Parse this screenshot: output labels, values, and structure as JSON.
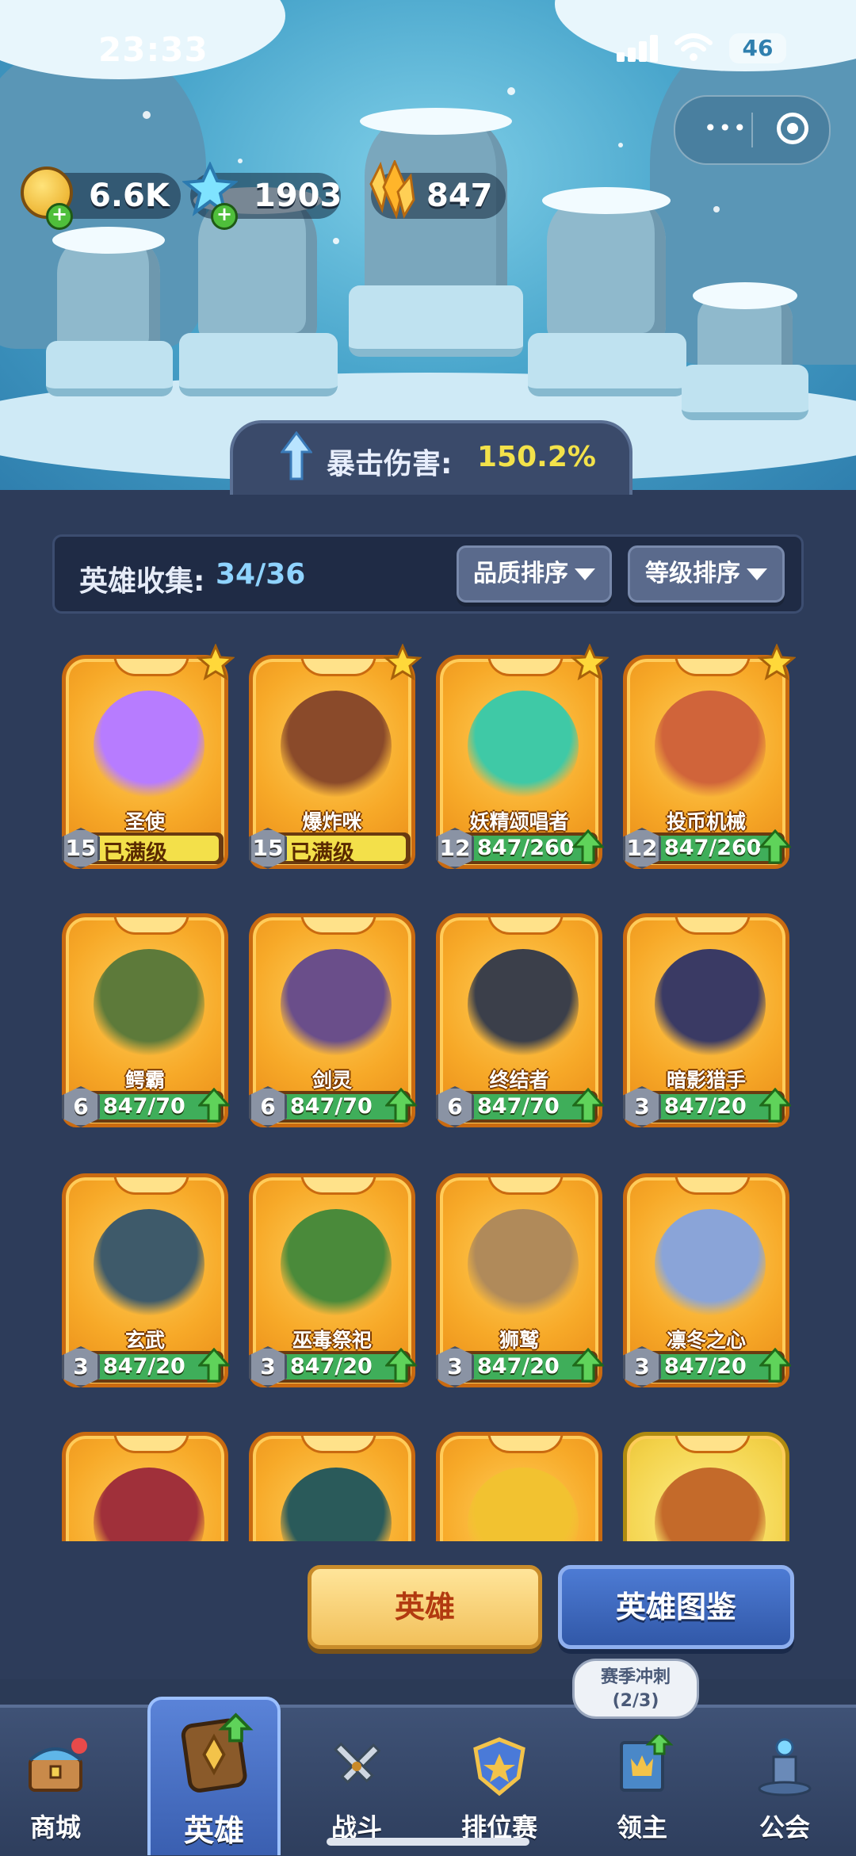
{
  "status_bar": {
    "time": "23:33",
    "battery": "46"
  },
  "currencies": [
    {
      "name": "gold-coin",
      "value": "6.6K"
    },
    {
      "name": "blue-gem",
      "value": "1903"
    },
    {
      "name": "orange-crystal",
      "value": "847"
    }
  ],
  "crit": {
    "label": "暴击伤害:",
    "value": "150.2%"
  },
  "collection": {
    "label": "英雄收集:",
    "count": "34/36"
  },
  "sort": {
    "quality": "品质排序",
    "level": "等级排序"
  },
  "heroes": [
    {
      "name": "圣使",
      "level": "15",
      "progress": "已满级",
      "maxed": true,
      "starred": true,
      "color": "#b77cff"
    },
    {
      "name": "爆炸咪",
      "level": "15",
      "progress": "已满级",
      "maxed": true,
      "starred": true,
      "color": "#8a4a2a"
    },
    {
      "name": "妖精颂唱者",
      "level": "12",
      "progress": "847/260",
      "maxed": false,
      "starred": true,
      "color": "#3fc9a6"
    },
    {
      "name": "投币机械",
      "level": "12",
      "progress": "847/260",
      "maxed": false,
      "starred": true,
      "color": "#d0643a"
    },
    {
      "name": "鳄霸",
      "level": "6",
      "progress": "847/70",
      "maxed": false,
      "starred": false,
      "color": "#5d7a3a"
    },
    {
      "name": "剑灵",
      "level": "6",
      "progress": "847/70",
      "maxed": false,
      "starred": false,
      "color": "#6a4e8a"
    },
    {
      "name": "终结者",
      "level": "6",
      "progress": "847/70",
      "maxed": false,
      "starred": false,
      "color": "#3b3f4a"
    },
    {
      "name": "暗影猎手",
      "level": "3",
      "progress": "847/20",
      "maxed": false,
      "starred": false,
      "color": "#3a3a64"
    },
    {
      "name": "玄武",
      "level": "3",
      "progress": "847/20",
      "maxed": false,
      "starred": false,
      "color": "#3e5a6a"
    },
    {
      "name": "巫毒祭祀",
      "level": "3",
      "progress": "847/20",
      "maxed": false,
      "starred": false,
      "color": "#4a8a3a"
    },
    {
      "name": "狮鹫",
      "level": "3",
      "progress": "847/20",
      "maxed": false,
      "starred": false,
      "color": "#b08a5a"
    },
    {
      "name": "凛冬之心",
      "level": "3",
      "progress": "847/20",
      "maxed": false,
      "starred": false,
      "color": "#8aa4d8"
    },
    {
      "name": "",
      "level": "",
      "progress": "",
      "maxed": false,
      "starred": false,
      "color": "#a0303a"
    },
    {
      "name": "",
      "level": "",
      "progress": "",
      "maxed": false,
      "starred": false,
      "color": "#2a5a5a"
    },
    {
      "name": "",
      "level": "",
      "progress": "",
      "maxed": false,
      "starred": false,
      "color": "#f2c230"
    },
    {
      "name": "",
      "level": "",
      "progress": "",
      "maxed": false,
      "starred": false,
      "color": "#c46a2a"
    }
  ],
  "buttons": {
    "heroes": "英雄",
    "codex": "英雄图鉴"
  },
  "season": {
    "title": "赛季冲刺",
    "progress": "(2/3)"
  },
  "tabs": [
    {
      "label": "商城",
      "icon": "treasure-chest-icon"
    },
    {
      "label": "英雄",
      "icon": "hero-card-icon"
    },
    {
      "label": "战斗",
      "icon": "crossed-swords-icon"
    },
    {
      "label": "排位赛",
      "icon": "rank-shield-icon"
    },
    {
      "label": "领主",
      "icon": "lord-banner-icon"
    },
    {
      "label": "公会",
      "icon": "guild-tower-icon"
    }
  ]
}
